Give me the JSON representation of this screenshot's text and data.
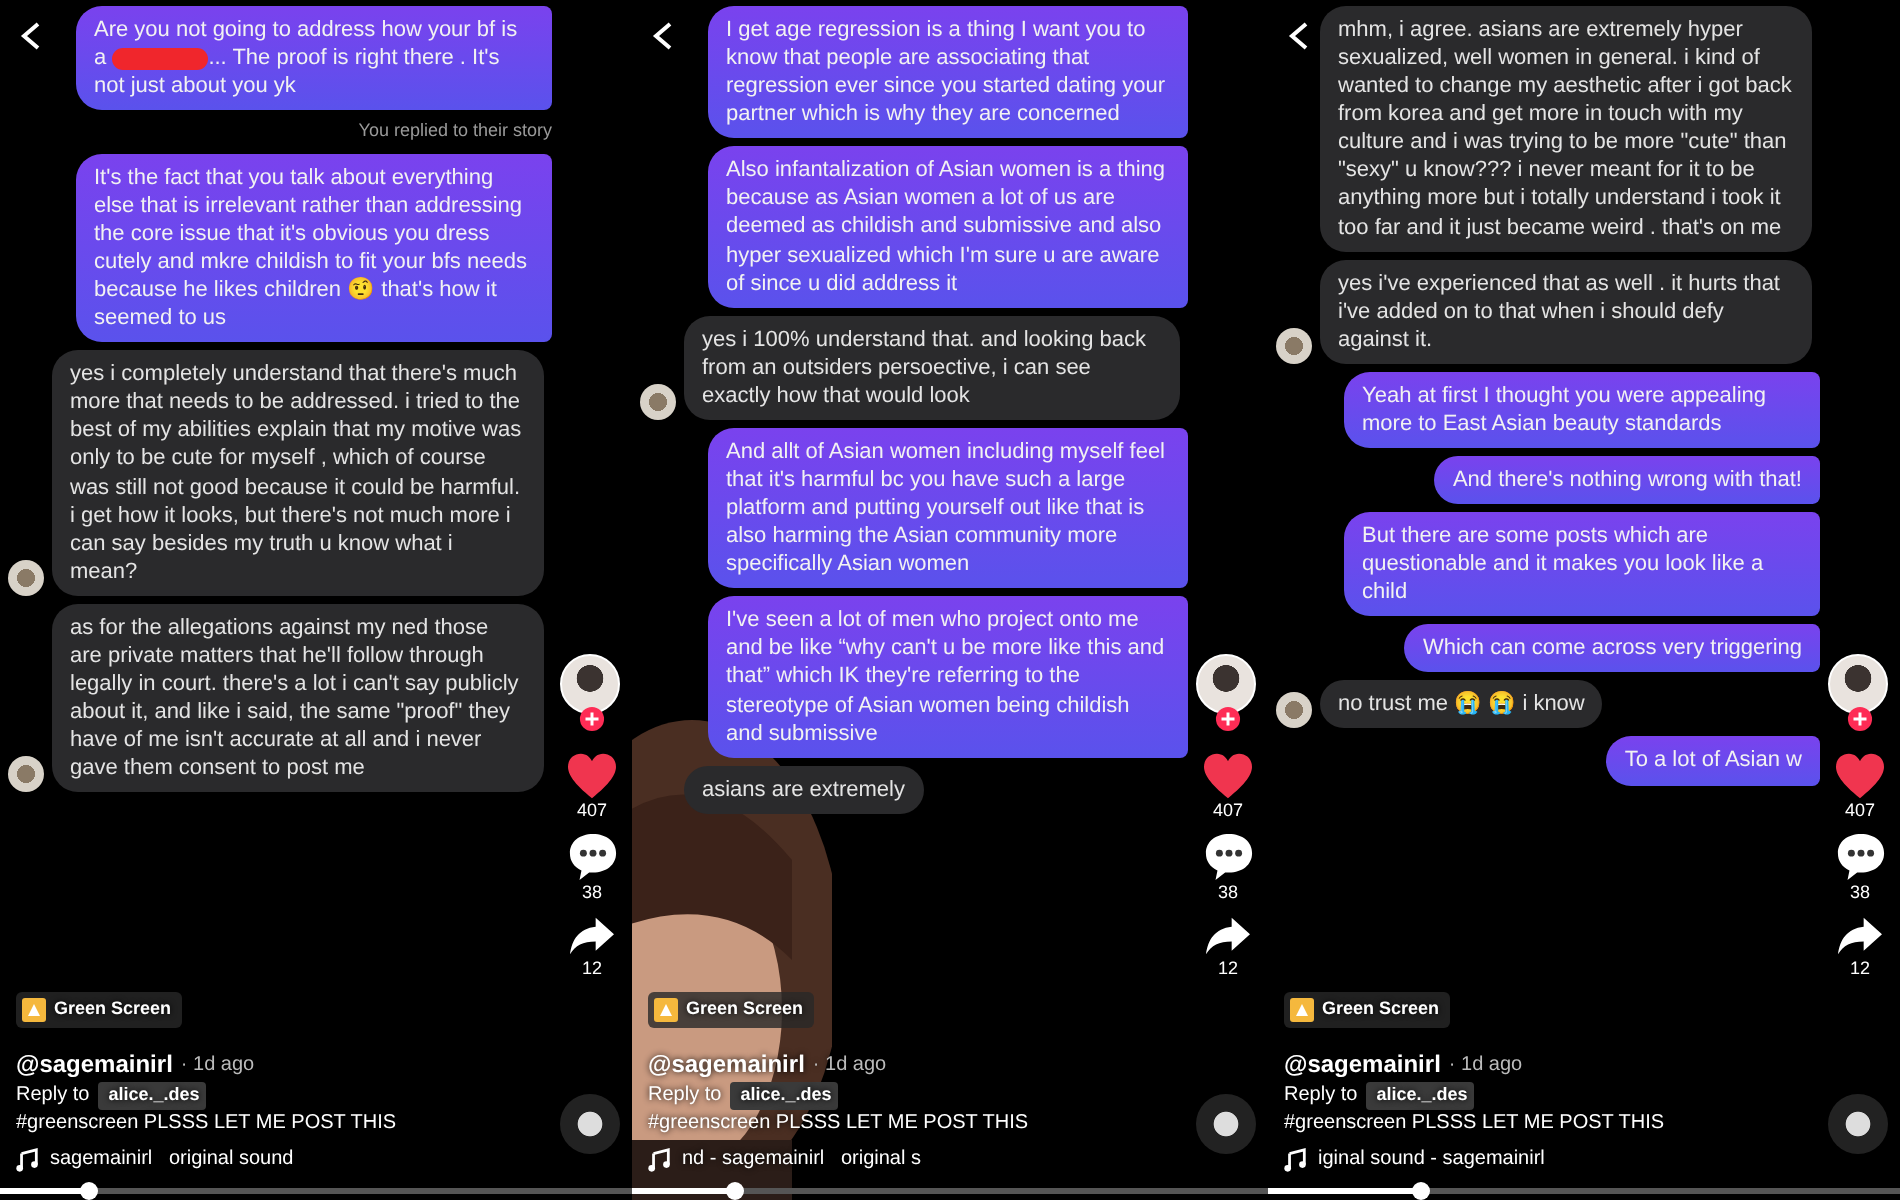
{
  "panels": [
    {
      "messages": [
        {
          "kind": "sent",
          "text": "Are you not going to address how your bf is a",
          "redacted": true,
          "text_after": "... The proof is right there . It's not just about you yk"
        },
        {
          "kind": "note",
          "text": "You replied to their story"
        },
        {
          "kind": "sent",
          "text": "It's the fact that you talk about everything else that is irrelevant rather than addressing the core issue that it's obvious you dress cutely and mkre childish to fit your bfs needs because he likes children 🤨 that's how it seemed to us"
        },
        {
          "kind": "received",
          "avatar": true,
          "text": "yes i completely understand that there's much more that needs to be addressed. i tried to the best of my abilities explain that my motive was only to be cute for myself , which of course was still not good because it could be harmful. i get how it looks, but there's not much more i can say besides my truth u know what i mean?"
        },
        {
          "kind": "received",
          "avatar": true,
          "text": "as for the allegations against my ned those are private matters that he'll follow through legally in court. there's a lot i can't say publicly about it, and like i said, the same \"proof\" they have of me isn't accurate at all and i never gave them consent to post me"
        }
      ],
      "creator": {
        "username": "@sagemainirl",
        "time": "· 1d ago",
        "effect": "Green Screen",
        "reply_prefix": "Reply to",
        "reply_user": "alice._.des",
        "caption": "#greenscreen PLSSS LET ME POST THIS",
        "sound": "sagemainirl   original sound"
      },
      "likes": "407",
      "liked": true,
      "comments": "38",
      "shares": "12",
      "progress": {
        "level": 0.14
      }
    },
    {
      "messages": [
        {
          "kind": "sent",
          "text": "I get age regression is a thing I want you to know that people are associating that regression ever since you started dating your partner which is why they are concerned"
        },
        {
          "kind": "sent",
          "text": "Also infantalization of Asian women is a thing because as Asian women a lot of us are deemed as childish and submissive and also hyper sexualized which I'm sure u are aware of since u did address it"
        },
        {
          "kind": "received",
          "avatar": true,
          "text": "yes i 100% understand that. and looking back from an outsiders persoective, i can see exactly how that would look"
        },
        {
          "kind": "sent",
          "text": "And allt of Asian women including myself feel that it's harmful bc you have such a large platform and putting yourself out like that is also harming the Asian community more specifically Asian women"
        },
        {
          "kind": "sent",
          "text": "I've seen a lot of men who project onto me and be like “why can't u be more like this and that” which IK they're referring to the stereotype of Asian women being childish and submissive"
        },
        {
          "kind": "received",
          "avatar": false,
          "text": "asians are extremely"
        }
      ],
      "creator": {
        "username": "@sagemainirl",
        "time": "· 1d ago",
        "effect": "Green Screen",
        "reply_prefix": "Reply to",
        "reply_user": "alice._.des",
        "caption": "#greenscreen PLSSS LET ME POST THIS",
        "sound": "nd - sagemainirl   original s"
      },
      "likes": "407",
      "liked": true,
      "comments": "38",
      "shares": "12",
      "progress": {
        "level": 0.16
      }
    },
    {
      "messages": [
        {
          "kind": "received",
          "avatar": false,
          "text": "mhm, i agree. asians are extremely hyper sexualized, well women in general. i kind of wanted to change my aesthetic after i got back from korea and get more in touch with my culture and i was trying to be more \"cute\" than \"sexy\" u know??? i never meant for it to be anything more but i totally understand i took it too far and it just became weird . that's on me"
        },
        {
          "kind": "received",
          "avatar": true,
          "text": "yes i've experienced that as well . it hurts that i've added on to that when i should defy against it."
        },
        {
          "kind": "sent",
          "text": "Yeah at first I thought you were appealing more to East Asian beauty standards"
        },
        {
          "kind": "sent",
          "text": "And there's nothing wrong with that!"
        },
        {
          "kind": "sent",
          "text": "But there are some posts which are questionable and it makes you look like a child"
        },
        {
          "kind": "sent",
          "text": "Which can come across very triggering"
        },
        {
          "kind": "received",
          "avatar": true,
          "text": "no trust me 😭 😭 i know"
        },
        {
          "kind": "sent",
          "text": "To a lot of Asian w"
        }
      ],
      "creator": {
        "username": "@sagemainirl",
        "time": "· 1d ago",
        "effect": "Green Screen",
        "reply_prefix": "Reply to",
        "reply_user": "alice._.des",
        "caption": "#greenscreen PLSSS LET ME POST THIS",
        "sound": "iginal sound - sagemainirl"
      },
      "likes": "407",
      "liked": true,
      "comments": "38",
      "shares": "12",
      "progress": {
        "level": 0.24
      }
    }
  ]
}
